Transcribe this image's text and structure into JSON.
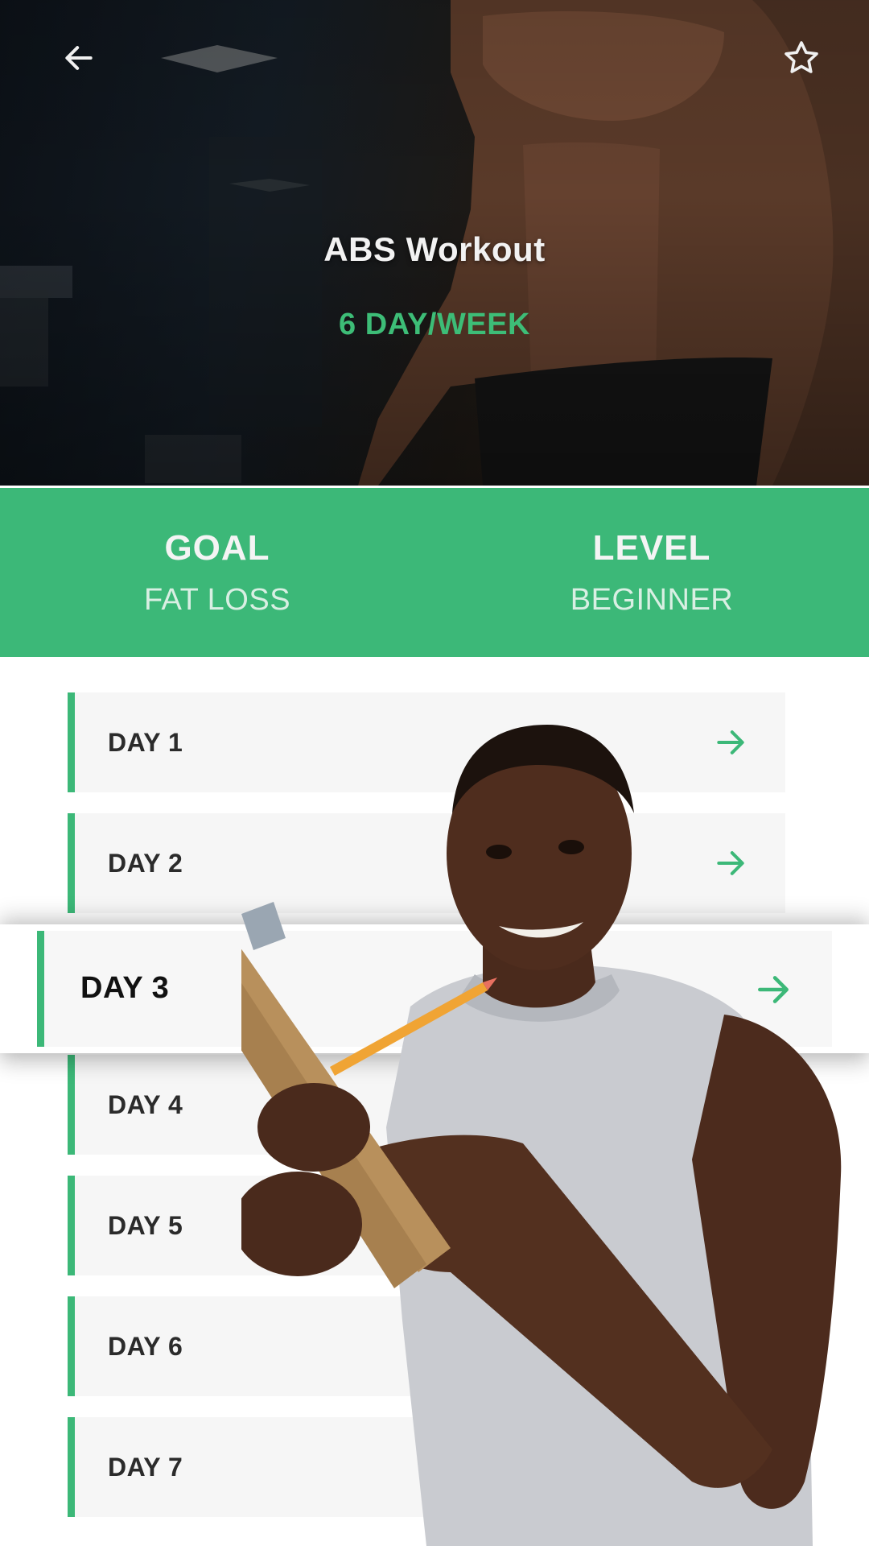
{
  "hero": {
    "title": "ABS Workout",
    "subtitle": "6 DAY/WEEK",
    "back_icon": "arrow-left-icon",
    "favorite_icon": "star-outline-icon"
  },
  "info": {
    "goal_label": "GOAL",
    "goal_value": "FAT LOSS",
    "level_label": "LEVEL",
    "level_value": "BEGINNER"
  },
  "days": [
    {
      "label": "DAY 1"
    },
    {
      "label": "DAY 2"
    },
    {
      "label": "DAY 3"
    },
    {
      "label": "DAY 4"
    },
    {
      "label": "DAY 5"
    },
    {
      "label": "DAY 6"
    },
    {
      "label": "DAY 7"
    }
  ],
  "colors": {
    "accent": "#3cb878",
    "card_bg": "#f6f6f6",
    "hero_bg": "#131b23"
  },
  "icons": {
    "day_arrow": "arrow-right-icon"
  }
}
